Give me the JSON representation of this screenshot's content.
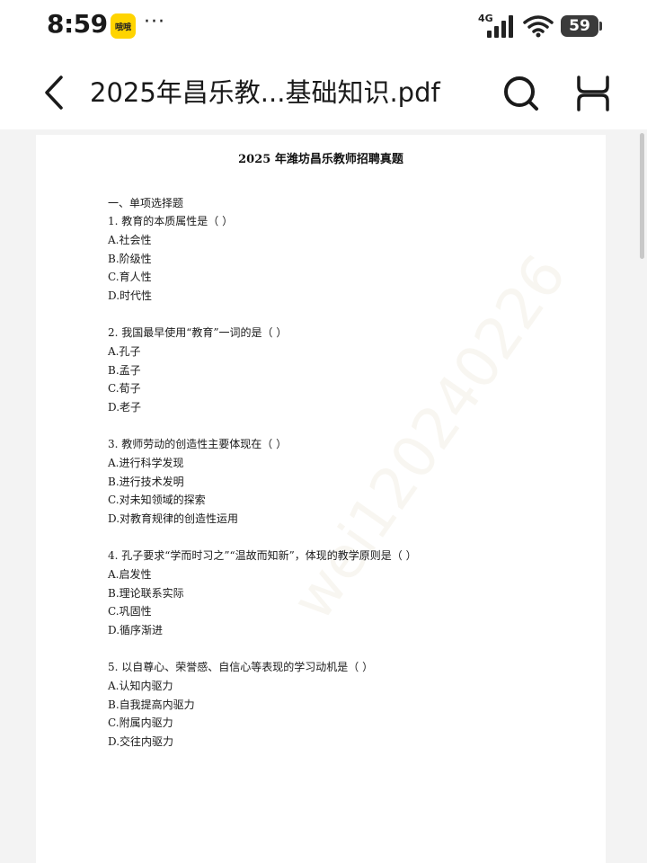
{
  "status_bar": {
    "time": "8:59",
    "app_badge": "哦哦",
    "more": "···",
    "network": "4G",
    "battery": "59"
  },
  "title_bar": {
    "title": "2025年昌乐教...基础知识.pdf"
  },
  "document": {
    "heading": "2025 年潍坊昌乐教师招聘真题",
    "section": "一、单项选择题",
    "watermark": "wei120240226",
    "questions": [
      {
        "text": "1. 教育的本质属性是（ ）",
        "options": [
          "A.社会性",
          "B.阶级性",
          "C.育人性",
          "D.时代性"
        ]
      },
      {
        "text": "2. 我国最早使用“教育”一词的是（ ）",
        "options": [
          "A.孔子",
          "B.孟子",
          "C.荀子",
          "D.老子"
        ]
      },
      {
        "text": "3. 教师劳动的创造性主要体现在（ ）",
        "options": [
          "A.进行科学发现",
          "B.进行技术发明",
          "C.对未知领域的探索",
          "D.对教育规律的创造性运用"
        ]
      },
      {
        "text": "4. 孔子要求“学而时习之”“温故而知新”，体现的教学原则是（ ）",
        "options": [
          "A.启发性",
          "B.理论联系实际",
          "C.巩固性",
          "D.循序渐进"
        ]
      },
      {
        "text": "5. 以自尊心、荣誉感、自信心等表现的学习动机是（ ）",
        "options": [
          "A.认知内驱力",
          "B.自我提高内驱力",
          "C.附属内驱力",
          "D.交往内驱力"
        ]
      }
    ]
  },
  "icons": {
    "back": "chevron-left-icon",
    "search": "search-icon",
    "fullscreen": "fullscreen-icon"
  }
}
